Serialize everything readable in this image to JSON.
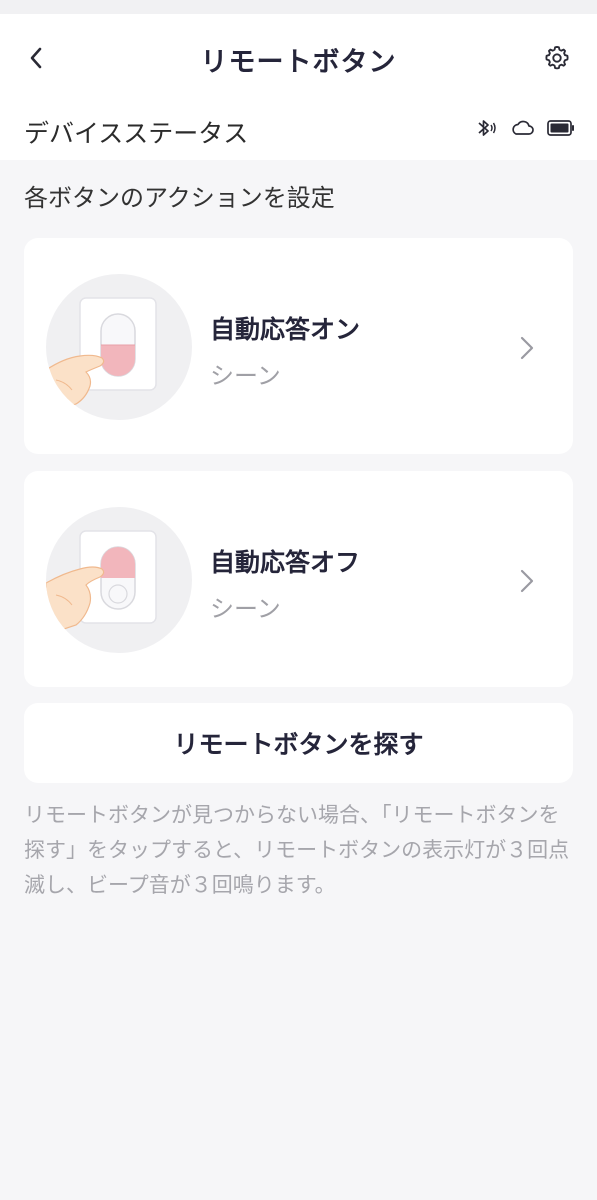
{
  "header": {
    "title": "リモートボタン"
  },
  "device_status": {
    "label": "デバイスステータス",
    "icons": [
      "bluetooth-icon",
      "cloud-icon",
      "battery-icon"
    ]
  },
  "section": {
    "label": "各ボタンのアクションを設定"
  },
  "actions": [
    {
      "name": "自動応答オン",
      "type": "シーン",
      "active_button": "bottom"
    },
    {
      "name": "自動応答オフ",
      "type": "シーン",
      "active_button": "top"
    }
  ],
  "find_button": {
    "label": "リモートボタンを探す"
  },
  "description": "リモートボタンが見つからない場合、「リモートボタンを探す」をタップすると、リモートボタンの表示灯が３回点滅し、ビープ音が３回鳴ります。",
  "colors": {
    "button_pink": "#f2b6bc",
    "title": "#25253a",
    "muted": "#a6a6ac"
  }
}
